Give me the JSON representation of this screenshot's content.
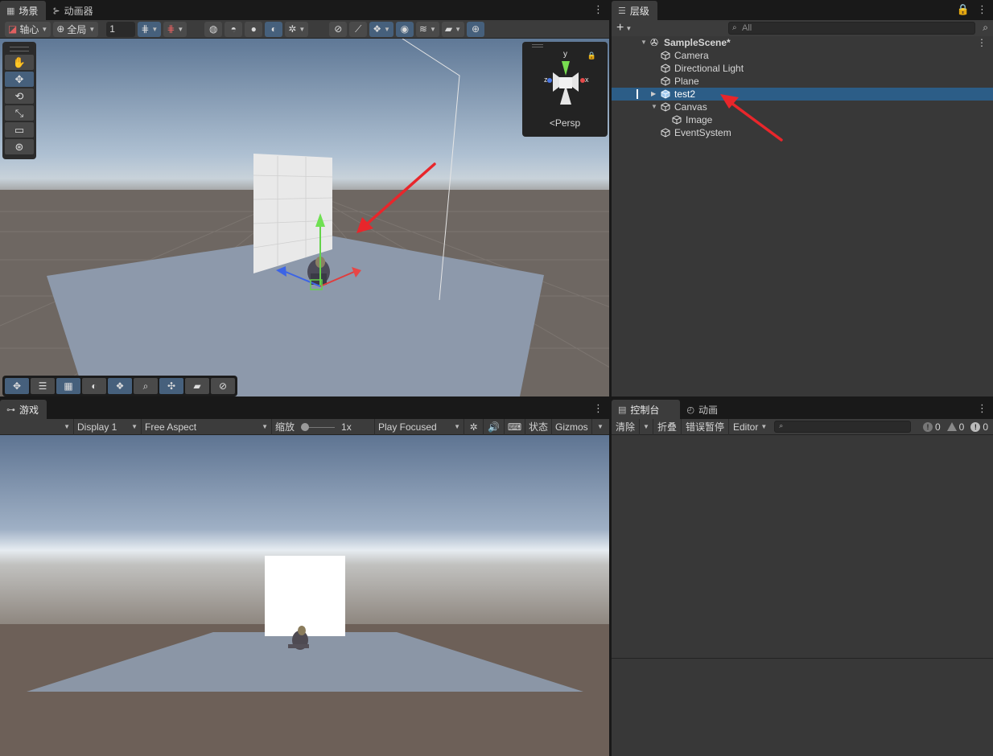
{
  "scene_panel": {
    "tabs": [
      {
        "label": "场景",
        "icon": "grid-icon"
      },
      {
        "label": "动画器",
        "icon": "animator-icon"
      }
    ],
    "toolbar": {
      "pivot_label": "轴心",
      "global_label": "全局",
      "grid_size": "1"
    },
    "view_mode_label": "Persp"
  },
  "hierarchy": {
    "tab_label": "层级",
    "search_placeholder": "All",
    "scene_name": "SampleScene*",
    "items": [
      {
        "label": "Camera"
      },
      {
        "label": "Directional Light"
      },
      {
        "label": "Plane"
      },
      {
        "label": "test2"
      },
      {
        "label": "Canvas"
      },
      {
        "label": "Image"
      },
      {
        "label": "EventSystem"
      }
    ]
  },
  "game_panel": {
    "tab_label": "游戏",
    "display": "Display 1",
    "aspect": "Free Aspect",
    "scale_label": "缩放",
    "scale_value": "1x",
    "play_mode": "Play Focused",
    "stats_label": "状态",
    "gizmos_label": "Gizmos"
  },
  "console_panel": {
    "tabs": [
      {
        "label": "控制台",
        "icon": "console-icon"
      },
      {
        "label": "动画",
        "icon": "clock-icon"
      }
    ],
    "clear_label": "清除",
    "collapse_label": "折叠",
    "error_pause_label": "错误暂停",
    "editor_label": "Editor",
    "log_count": "0",
    "warning_count": "0",
    "error_count": "0"
  },
  "colors": {
    "selection": "#2c5d87",
    "active_button": "#46607c",
    "annotation_arrow": "#e8262b"
  }
}
